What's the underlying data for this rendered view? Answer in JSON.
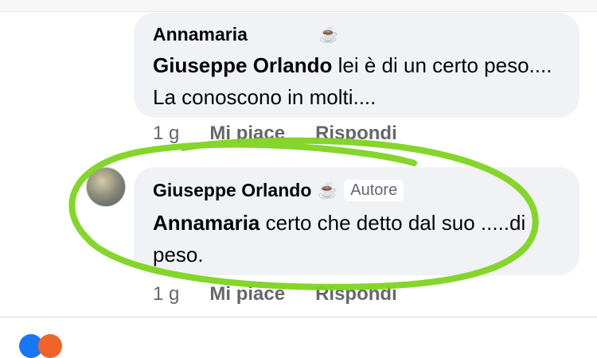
{
  "comments": [
    {
      "author": "Annamaria",
      "icon": "coffee-cup-icon",
      "mention": "Giuseppe Orlando",
      "text": " lei è di un certo peso.... La conoscono in molti....",
      "time": "1 g",
      "like_label": "Mi piace",
      "reply_label": "Rispondi"
    },
    {
      "author": "Giuseppe Orlando",
      "icon": "coffee-cup-icon",
      "badge": "Autore",
      "mention": "Annamaria",
      "text": " certo che detto dal suo .....di peso.",
      "time": "1 g",
      "like_label": "Mi piace",
      "reply_label": "Rispondi"
    }
  ],
  "colors": {
    "bubble": "#f0f2f5",
    "secondary_text": "#65676b",
    "highlight_circle": "#7ed321"
  }
}
